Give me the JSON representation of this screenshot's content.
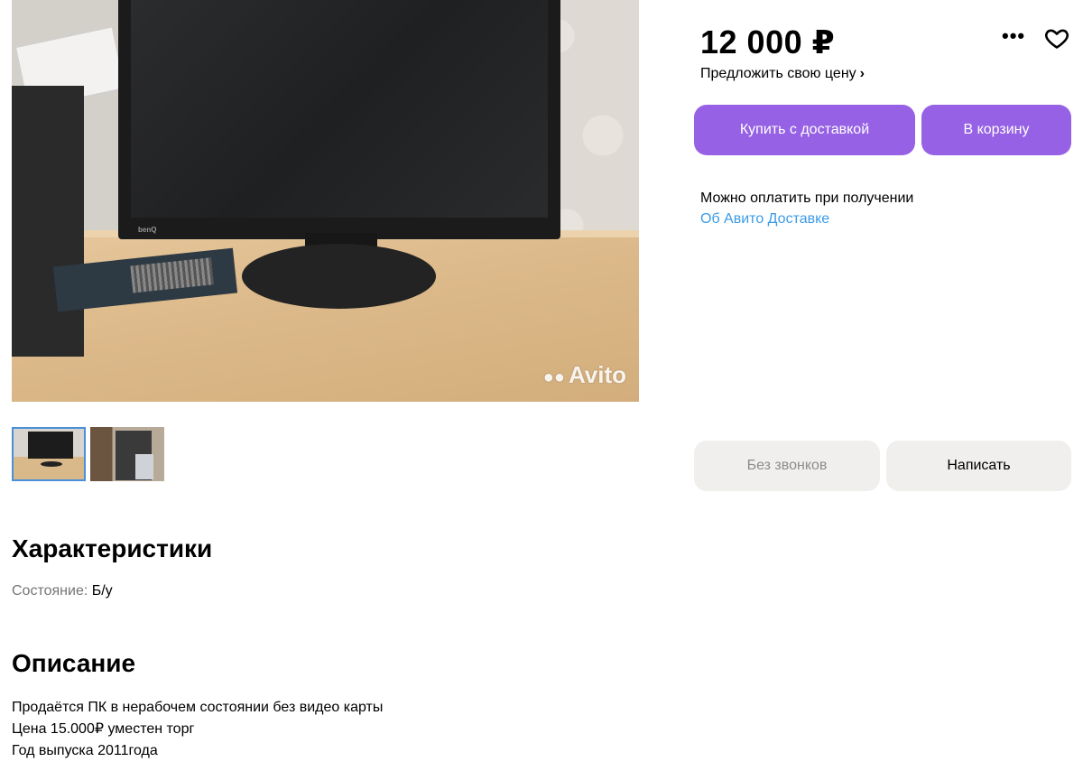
{
  "gallery": {
    "watermark": "Avito",
    "monitor_brand": "benQ",
    "thumbnails": [
      {
        "name": "monitor-photo",
        "active": true
      },
      {
        "name": "pc-case-photo",
        "active": false
      }
    ]
  },
  "listing": {
    "price": "12 000 ₽",
    "offer_price_label": "Предложить свою цену",
    "buy_delivery_label": "Купить с доставкой",
    "cart_label": "В корзину",
    "pay_on_receipt": "Можно оплатить при получении",
    "delivery_link": "Об Авито Доставке",
    "no_calls_label": "Без звонков",
    "write_label": "Написать"
  },
  "specs": {
    "title": "Характеристики",
    "items": [
      {
        "key": "Состояние:",
        "value": "Б/у"
      }
    ]
  },
  "description": {
    "title": "Описание",
    "lines": [
      "Продаётся ПК в нерабочем состоянии без видео карты",
      "Цена 15.000₽ уместен торг",
      "Год выпуска 2011года"
    ]
  },
  "colors": {
    "accent": "#9661e5",
    "link": "#3a9be8",
    "secondary_button": "#f0efed"
  }
}
